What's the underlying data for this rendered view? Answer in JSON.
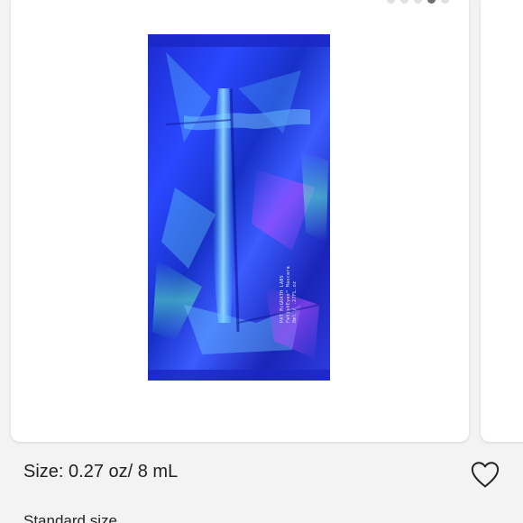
{
  "carousel": {
    "dot_count": 5,
    "active_dot_index": 3,
    "product_image": {
      "alt": "Holographic blue foil sample sachet",
      "label_lines": [
        "PAT McGRATH LABS",
        "FetishEyes™ Mascara",
        "8ml / .27FL.oz"
      ]
    }
  },
  "product": {
    "size_text": "Size: 0.27 oz/ 8 mL",
    "favorite_icon": "heart-outline-icon",
    "standard_text": "Standard size"
  },
  "colors": {
    "background": "#f3f3f3",
    "card": "#ffffff",
    "dot_inactive": "#e0e0e0",
    "dot_active": "#6f6f6f",
    "text": "#222222",
    "foil_blue": "#1f2fd6"
  }
}
